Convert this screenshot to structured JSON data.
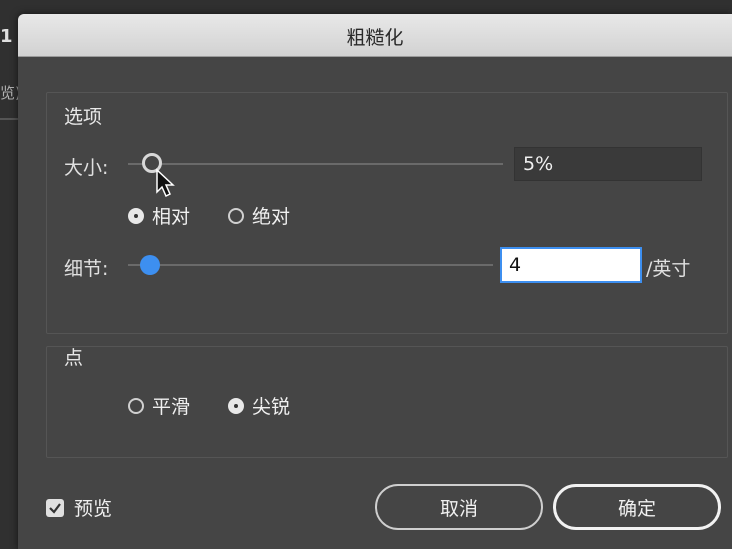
{
  "background": {
    "left_text_1": "1",
    "left_text_2": "览)"
  },
  "dialog": {
    "title": "粗糙化"
  },
  "options": {
    "group_label": "选项",
    "size": {
      "label": "大小:",
      "value": "5%",
      "slider_fraction": 0.05
    },
    "mode": {
      "relative_label": "相对",
      "absolute_label": "绝对",
      "selected": "relative"
    },
    "detail": {
      "label": "细节:",
      "value": "4",
      "unit": "/英寸",
      "slider_fraction": 0.04
    }
  },
  "points": {
    "group_label": "点",
    "smooth_label": "平滑",
    "corner_label": "尖锐",
    "selected": "corner"
  },
  "footer": {
    "preview_label": "预览",
    "preview_checked": true,
    "cancel_label": "取消",
    "ok_label": "确定"
  },
  "colors": {
    "accent": "#3d8ff0",
    "dialog_bg": "#454545"
  }
}
